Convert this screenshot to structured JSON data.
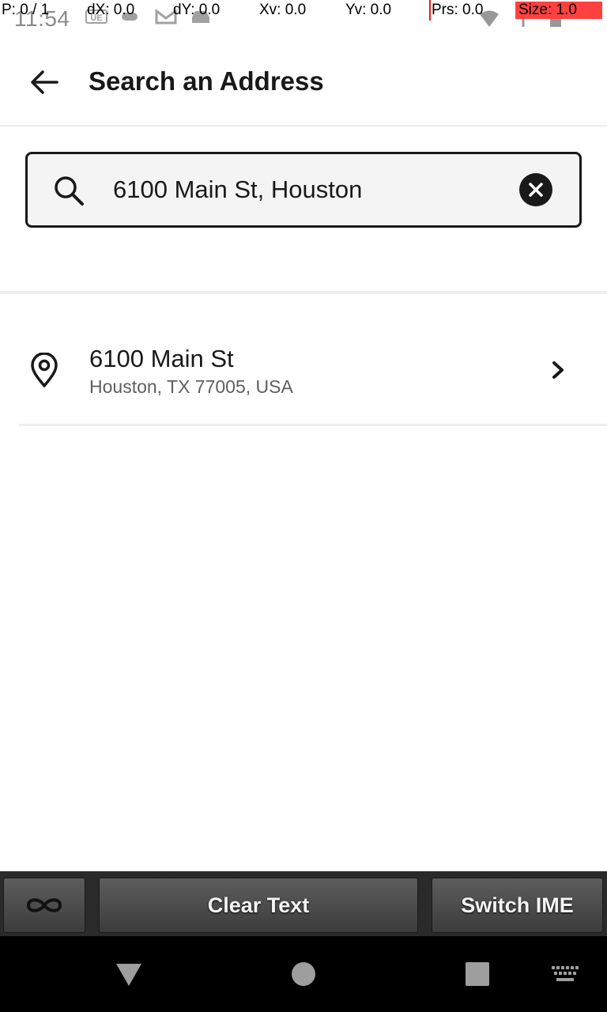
{
  "status_bar": {
    "time": "11:54",
    "left_icons": [
      "ue-icon",
      "chat-icon",
      "gmail-icon",
      "car-icon"
    ],
    "right_icons": [
      "wifi-icon",
      "signal-icon",
      "battery-icon"
    ]
  },
  "pointer_overlay": {
    "p": "P: 0 / 1",
    "dx": "dX: 0.0",
    "dy": "dY: 0.0",
    "xv": "Xv: 0.0",
    "yv": "Yv: 0.0",
    "prs": "Prs: 0.0",
    "size": "Size: 1.0"
  },
  "app_bar": {
    "back_icon": "arrow-left-icon",
    "title": "Search an Address"
  },
  "search": {
    "icon": "search-icon",
    "value": "6100 Main St, Houston",
    "clear_icon": "close-circle-icon"
  },
  "results": [
    {
      "icon": "location-pin-icon",
      "title": "6100 Main St",
      "subtitle": "Houston, TX 77005, USA",
      "chevron": "chevron-right-icon"
    }
  ],
  "ime_toolbar": {
    "loop_icon": "infinity-icon",
    "clear_text": "Clear Text",
    "switch_ime": "Switch IME"
  },
  "nav_bar": {
    "back": "nav-back-icon",
    "home": "nav-home-icon",
    "recents": "nav-recents-icon",
    "keyboard": "keyboard-icon"
  },
  "colors": {
    "text_primary": "#191919",
    "text_secondary": "#5f5f5f",
    "divider": "#eeeeee",
    "search_bg": "#f4f4f4",
    "overlay_size_bg": "#ff4040"
  }
}
